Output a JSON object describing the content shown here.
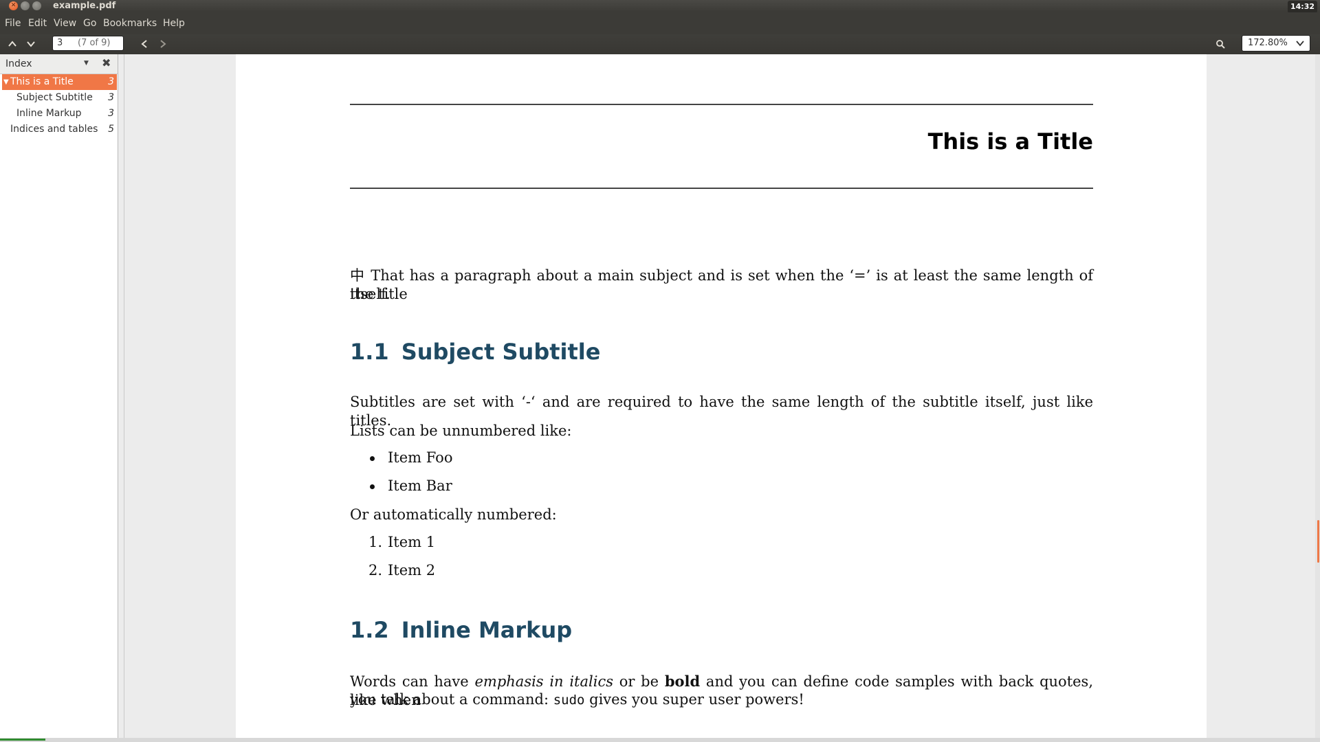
{
  "window": {
    "title": "example.pdf",
    "clock": "14:32",
    "close_glyph": "✕"
  },
  "menu": [
    "File",
    "Edit",
    "View",
    "Go",
    "Bookmarks",
    "Help"
  ],
  "toolbar": {
    "page_value": "3",
    "page_count": "(7 of 9)",
    "zoom": "172.80%"
  },
  "sidebar": {
    "title": "Index",
    "items": [
      {
        "label": "This is a Title",
        "page": "3"
      },
      {
        "label": "Subject Subtitle",
        "page": "3"
      },
      {
        "label": "Inline Markup",
        "page": "3"
      },
      {
        "label": "Indices and tables",
        "page": "5"
      }
    ]
  },
  "document": {
    "title": "This is a Title",
    "intro_line1": "中 That has a paragraph about a main subject and is set when the ‘=’ is at least the same length of the title",
    "intro_line2": "itself.",
    "section1": {
      "num": "1.1",
      "title": "Subject Subtitle",
      "para": "Subtitles are set with ‘-‘ and are required to have the same length of the subtitle itself, just like titles.",
      "lists_intro": "Lists can be unnumbered like:",
      "bullets": [
        "Item Foo",
        "Item Bar"
      ],
      "numbered_intro": "Or automatically numbered:",
      "numbered": [
        {
          "n": "1.",
          "text": "Item 1"
        },
        {
          "n": "2.",
          "text": "Item 2"
        }
      ]
    },
    "section2": {
      "num": "1.2",
      "title": "Inline Markup",
      "p1_a": "Words can have ",
      "p1_em": "emphasis in italics",
      "p1_b": " or be ",
      "p1_bold": "bold",
      "p1_c": " and you can define code samples with back quotes, like when",
      "p2_a": "you talk about a command: ",
      "p2_code": "sudo",
      "p2_b": " gives you super user powers!"
    }
  }
}
